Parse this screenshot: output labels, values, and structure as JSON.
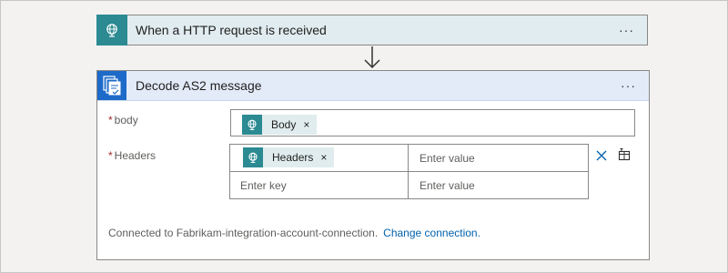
{
  "trigger": {
    "title": "When a HTTP request is received",
    "icon": "http-request-globe-icon",
    "more_label": "···"
  },
  "action": {
    "title": "Decode AS2 message",
    "icon": "as2-decode-icon",
    "more_label": "···",
    "fields": {
      "body": {
        "required_mark": "*",
        "label": "body",
        "token": {
          "label": "Body",
          "remove": "×",
          "icon": "http-request-globe-icon"
        }
      },
      "headers": {
        "required_mark": "*",
        "label": "Headers",
        "rows": [
          {
            "key_token": {
              "label": "Headers",
              "remove": "×",
              "icon": "http-request-globe-icon"
            },
            "value_placeholder": "Enter value"
          },
          {
            "key_placeholder": "Enter key",
            "value_placeholder": "Enter value"
          }
        ]
      }
    },
    "connection": {
      "text": "Connected to Fabrikam-integration-account-connection.",
      "link_label": "Change connection."
    }
  },
  "colors": {
    "trigger_accent": "#2b8a92",
    "action_accent": "#1d6ac9",
    "link": "#0062ad",
    "required": "#a4262c"
  }
}
